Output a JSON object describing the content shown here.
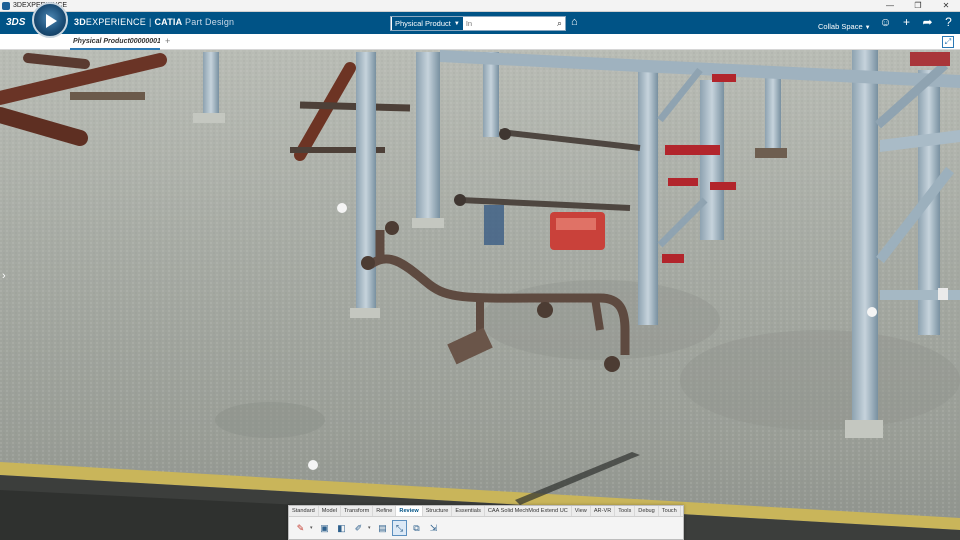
{
  "window": {
    "title": "3DEXPERIENCE",
    "controls": [
      "—",
      "❐",
      "✕"
    ]
  },
  "topbar": {
    "brand_prefix": "3D",
    "brand_main": "EXPERIENCE",
    "app_name": "CATIA",
    "app_module": "Part Design",
    "search": {
      "scope": "Physical Product",
      "placeholder": "In"
    },
    "collab_space": "Collab Space",
    "icons": [
      "user-icon",
      "add-icon",
      "share-icon",
      "help-icon"
    ]
  },
  "tabbar": {
    "doc_tab": "Physical Product00000001",
    "add": "+"
  },
  "actionbar": {
    "tabs": [
      "Standard",
      "Model",
      "Transform",
      "Refine",
      "Review",
      "Structure",
      "Essentials",
      "CAA Solid MechMod Extend UC",
      "View",
      "AR-VR",
      "Tools",
      "Debug",
      "Touch"
    ],
    "active_tab": "Review"
  }
}
